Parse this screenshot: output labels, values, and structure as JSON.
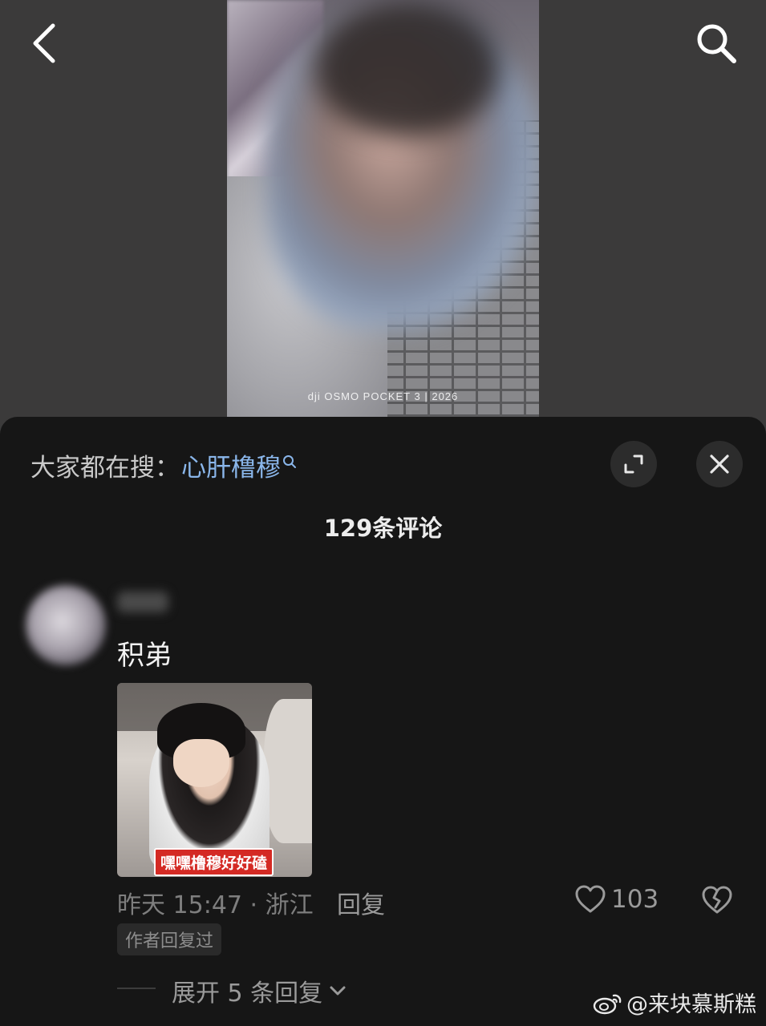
{
  "video": {
    "watermark": "dji OSMO POCKET 3 | 2026"
  },
  "nav": {
    "back_icon": "chevron-left-icon",
    "search_icon": "search-icon"
  },
  "sheet": {
    "search_prefix": "大家都在搜：",
    "search_keyword": "心肝橹穆",
    "comment_count": "129条评论",
    "expand_icon": "expand-icon",
    "close_icon": "close-icon"
  },
  "comment": {
    "text": "积弟",
    "image_caption": "嘿嘿橹穆好好磕",
    "time_location": "昨天 15:47 · 浙江",
    "reply_label": "回复",
    "like_count": "103",
    "author_badge": "作者回复过",
    "expand_label": "展开 5 条回复"
  },
  "watermark": {
    "text": "@来块慕斯糕"
  },
  "colors": {
    "sheet_bg": "#161616",
    "keyword": "#8ab6ea",
    "caption_red": "#d42a24"
  }
}
